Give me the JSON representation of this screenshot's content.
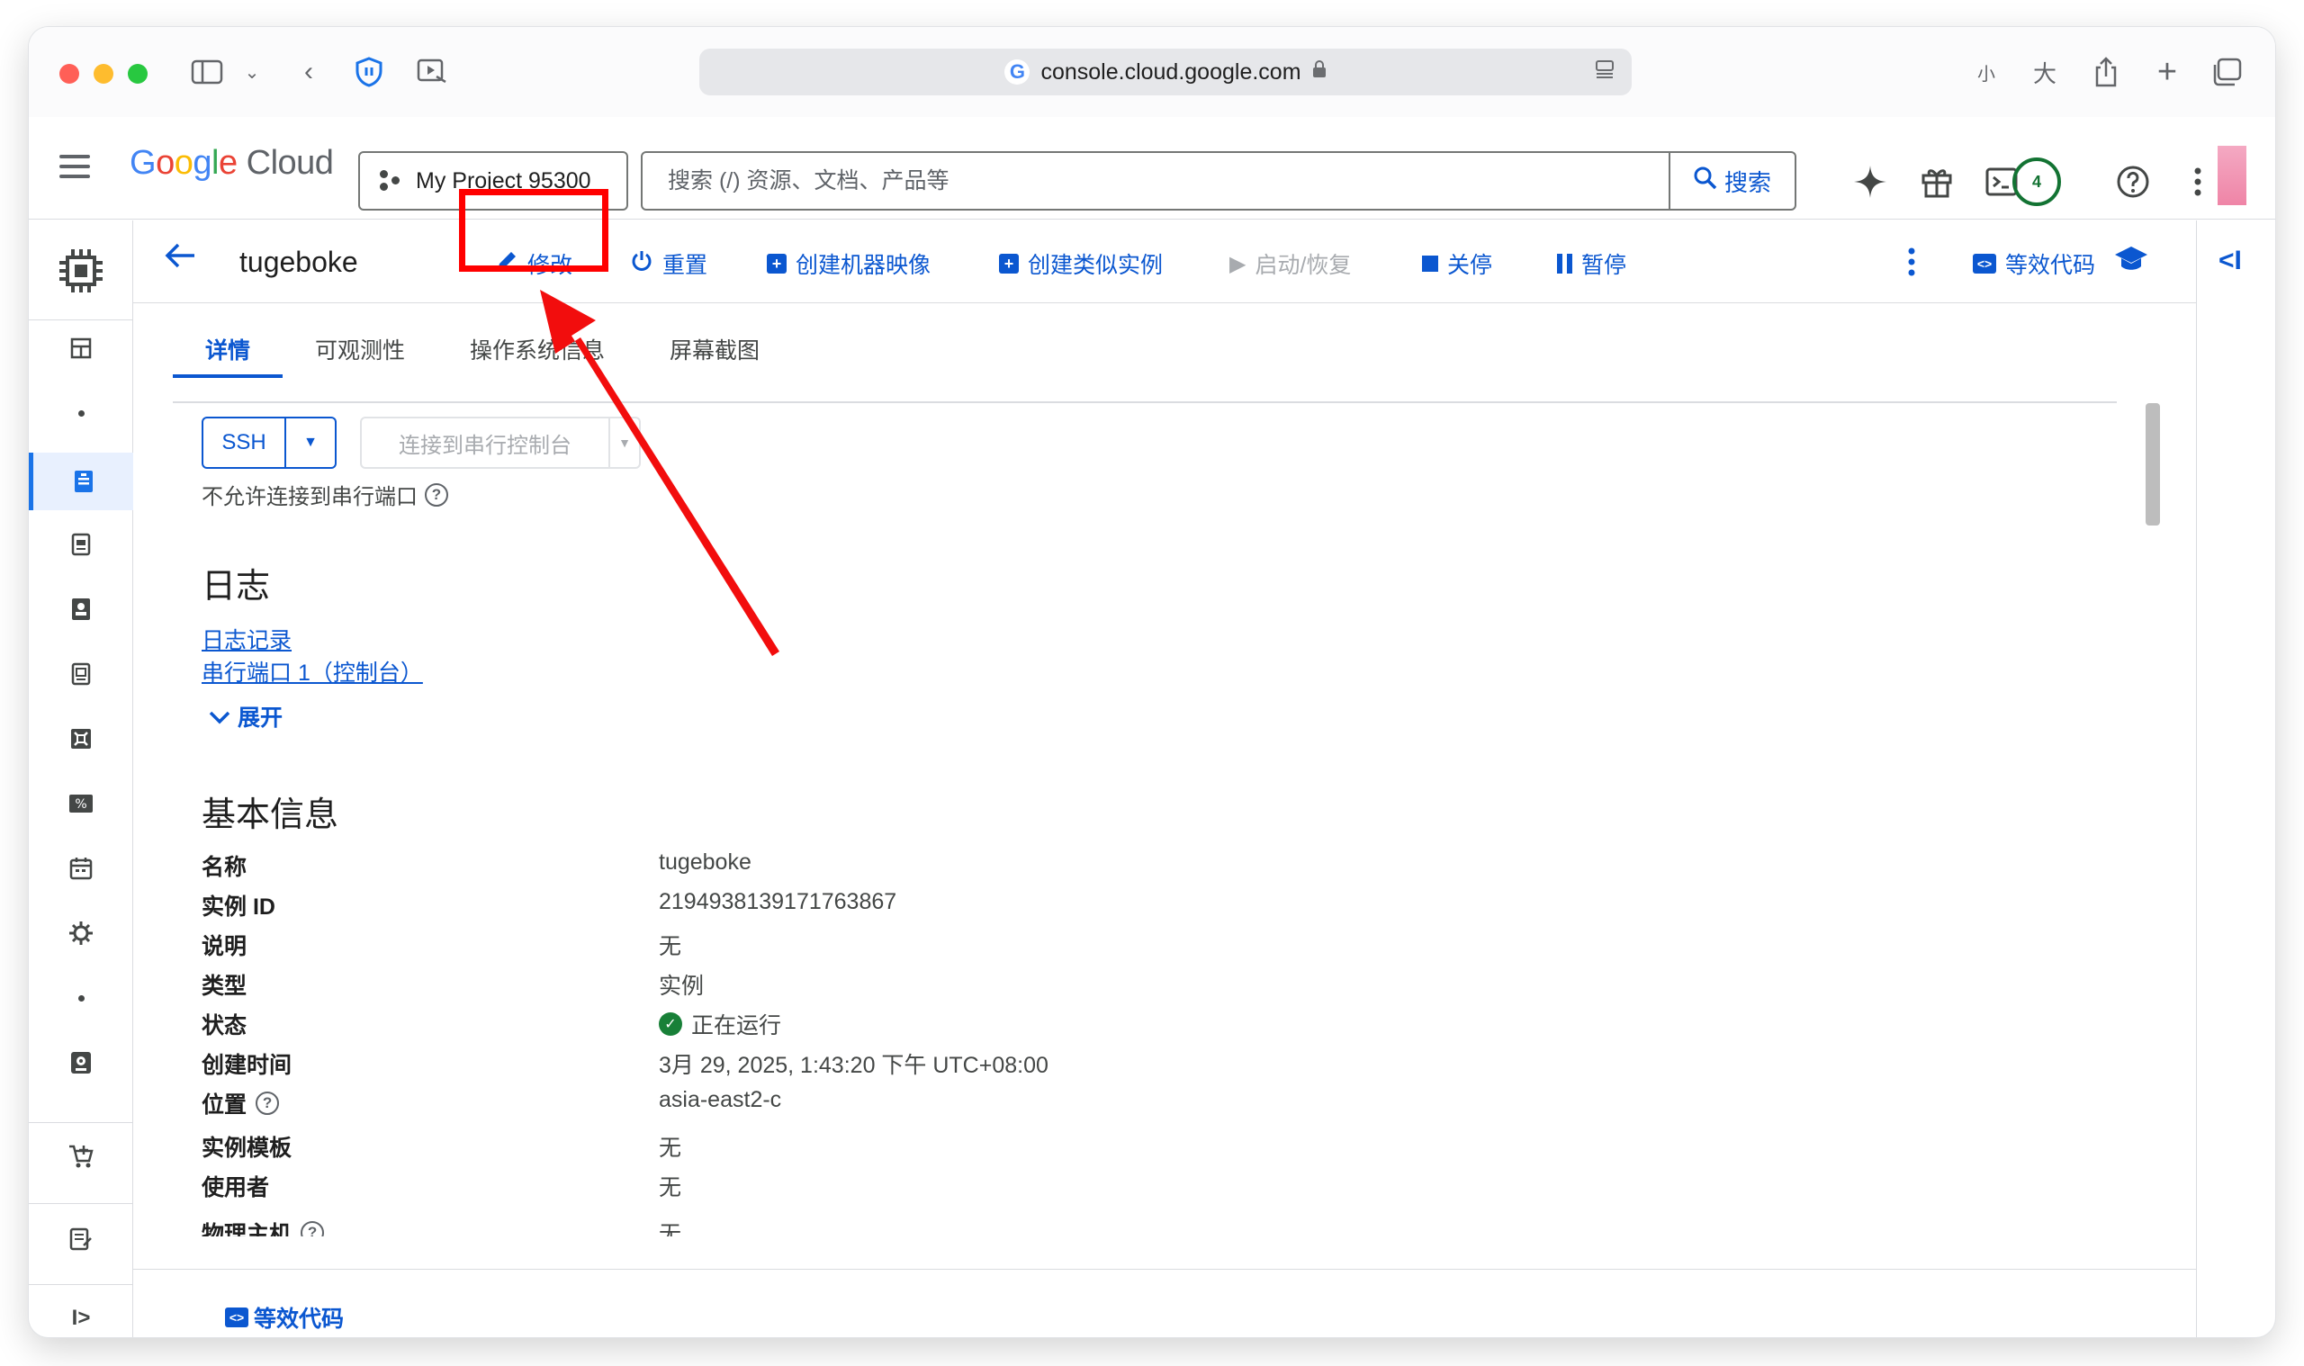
{
  "browser": {
    "url": "console.cloud.google.com",
    "text_size_small": "小",
    "text_size_large": "大"
  },
  "header": {
    "logo_word": "Google",
    "logo_product": "Cloud",
    "project": "My Project 95300",
    "search_placeholder": "搜索 (/) 资源、文档、产品等",
    "search_button": "搜索",
    "notification_count": "4"
  },
  "action_bar": {
    "title": "tugeboke",
    "edit": "修改",
    "reset": "重置",
    "create_image": "创建机器映像",
    "create_similar": "创建类似实例",
    "start_resume": "启动/恢复",
    "stop": "关停",
    "suspend": "暂停",
    "equivalent_code": "等效代码"
  },
  "tabs": [
    {
      "label": "详情",
      "active": true
    },
    {
      "label": "可观测性",
      "active": false
    },
    {
      "label": "操作系统信息",
      "active": false
    },
    {
      "label": "屏幕截图",
      "active": false
    }
  ],
  "connect": {
    "ssh": "SSH",
    "serial": "连接到串行控制台",
    "serial_note": "不允许连接到串行端口"
  },
  "logs": {
    "heading": "日志",
    "link1": "日志记录",
    "link2": "串行端口 1（控制台）",
    "expand": "展开"
  },
  "basic_info": {
    "heading": "基本信息",
    "rows": [
      {
        "label": "名称",
        "value": "tugeboke"
      },
      {
        "label": "实例 ID",
        "value": "2194938139171763867"
      },
      {
        "label": "说明",
        "value": "无"
      },
      {
        "label": "类型",
        "value": "实例"
      },
      {
        "label": "状态",
        "value": "正在运行"
      },
      {
        "label": "创建时间",
        "value": "3月 29, 2025, 1:43:20 下午 UTC+08:00"
      },
      {
        "label": "位置",
        "value": "asia-east2-c"
      },
      {
        "label": "实例模板",
        "value": "无"
      },
      {
        "label": "使用者",
        "value": "无"
      },
      {
        "label": "物理主机",
        "value": "无"
      }
    ]
  },
  "footer": {
    "equivalent_code": "等效代码"
  },
  "colors": {
    "accent": "#0b57d0",
    "highlight": "#ff0000",
    "running": "#188038"
  }
}
